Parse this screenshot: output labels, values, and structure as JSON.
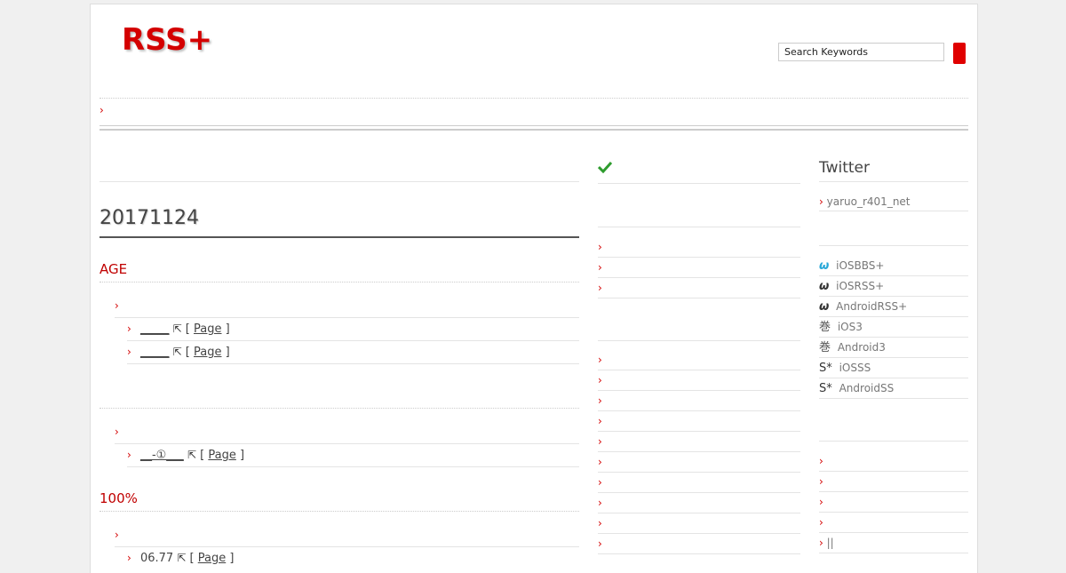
{
  "header": {
    "logo": "RSS+",
    "search_placeholder": "Search Keywords"
  },
  "nav": {
    "chevron": "›"
  },
  "main": {
    "date_title": "20171124",
    "sections": [
      {
        "title": "AGE",
        "links": [
          {
            "text": "_____",
            "bracket_open": "[",
            "page_label": "Page",
            "bracket_close": "]"
          },
          {
            "text": "_____",
            "bracket_open": "[",
            "page_label": "Page",
            "bracket_close": "]"
          }
        ]
      },
      {
        "title": "",
        "links": [
          {
            "text": "__-①___",
            "bracket_open": "[",
            "page_label": "Page",
            "bracket_close": "]"
          }
        ]
      },
      {
        "title": "100%",
        "links": [
          {
            "text": "06.77",
            "bracket_open": "[",
            "page_label": "Page",
            "bracket_close": "]"
          }
        ]
      }
    ]
  },
  "middle": {
    "check_icon": "check-icon"
  },
  "right": {
    "twitter_title": "Twitter",
    "twitter_account": "yaruo_r401_net",
    "apps": [
      {
        "icon": "ω",
        "label": "iOSBBS+",
        "color": "#29a8d8"
      },
      {
        "icon": "ω",
        "label": "iOSRSS+",
        "color": "#333333"
      },
      {
        "icon": "ω",
        "label": "AndroidRSS+",
        "color": "#333333"
      },
      {
        "icon": "巻",
        "label": "iOS3",
        "color": "#555555"
      },
      {
        "icon": "巻",
        "label": "Android3",
        "color": "#555555"
      },
      {
        "icon": "S*",
        "label": "iOSSS",
        "color": "#333333"
      },
      {
        "icon": "S*",
        "label": "AndroidSS",
        "color": "#333333"
      }
    ],
    "last_link": "||"
  }
}
